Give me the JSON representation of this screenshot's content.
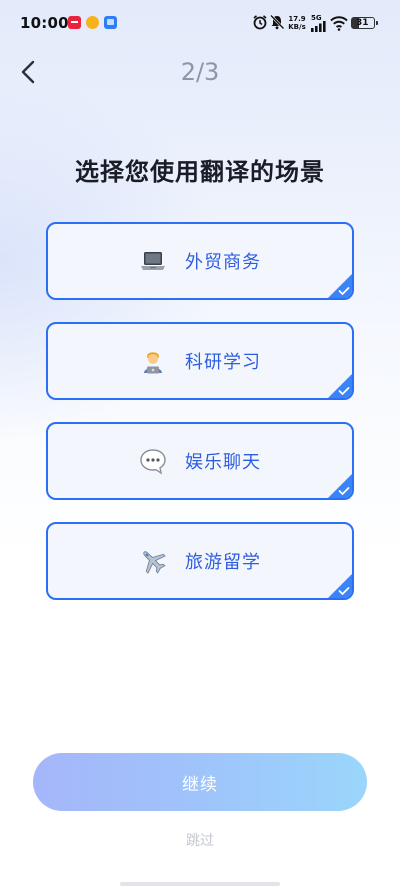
{
  "status_bar": {
    "time": "10:00",
    "net_speed_value": "17.9",
    "net_speed_unit": "KB/s",
    "network_type": "5G",
    "battery": "31",
    "icons": [
      "app-red-icon",
      "app-yellow-icon",
      "app-blue-icon",
      "alarm-icon",
      "mute-bell-icon",
      "signal-icon",
      "wifi-icon",
      "battery-icon"
    ]
  },
  "header": {
    "back_icon": "chevron-left-icon",
    "step": "2/3"
  },
  "title": "选择您使用翻译的场景",
  "options": [
    {
      "label": "外贸商务",
      "icon": "laptop-icon",
      "selected": true
    },
    {
      "label": "科研学习",
      "icon": "technologist-icon",
      "selected": true
    },
    {
      "label": "娱乐聊天",
      "icon": "speech-bubble-icon",
      "selected": true
    },
    {
      "label": "旅游留学",
      "icon": "airplane-icon",
      "selected": true
    }
  ],
  "footer": {
    "continue_label": "继续",
    "skip_label": "跳过"
  },
  "colors": {
    "accent": "#2a6ff5",
    "label": "#2f5de0",
    "check_corner": "#3a84f7",
    "button_gradient_start": "#a5b6fa",
    "button_gradient_end": "#9ad6fb"
  }
}
